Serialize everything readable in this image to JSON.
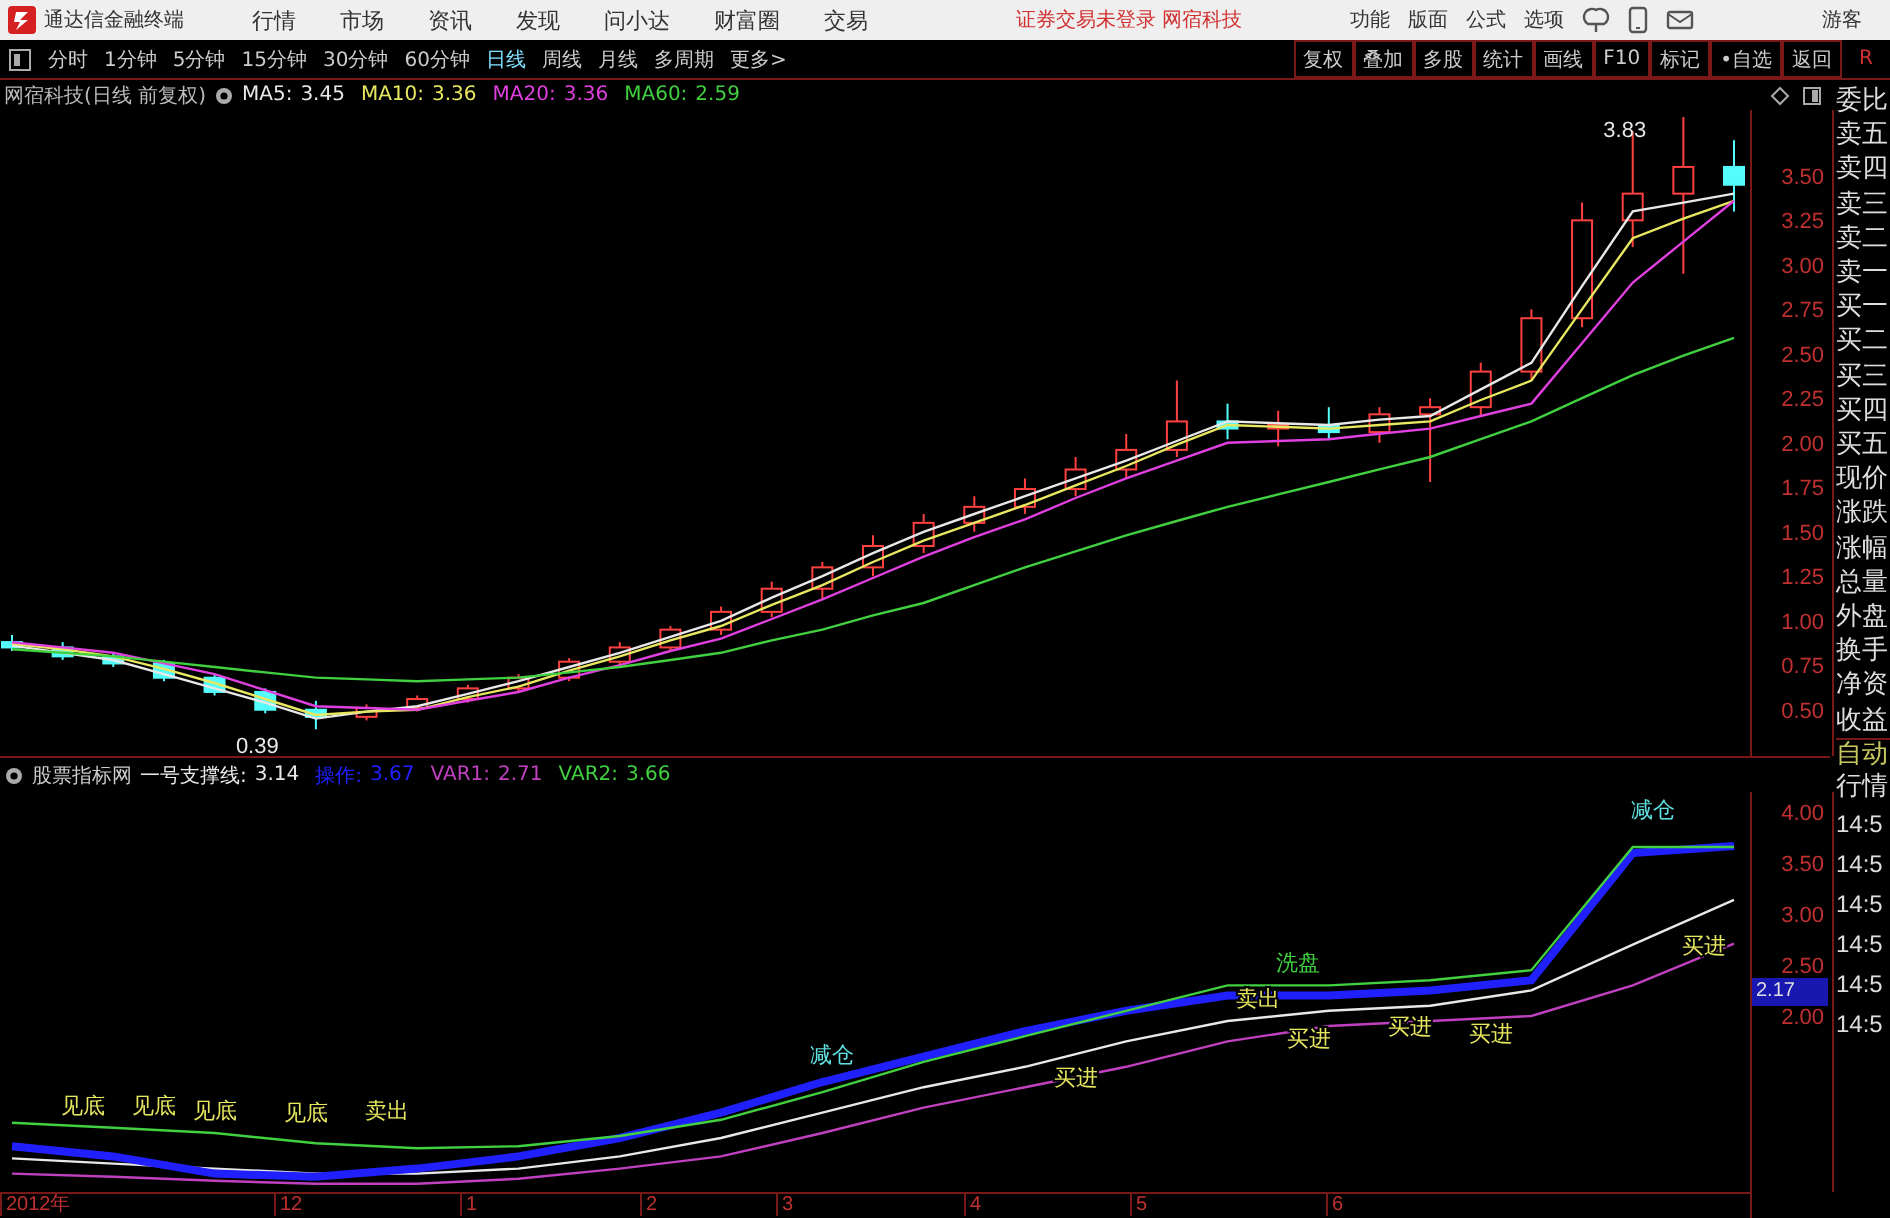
{
  "app": {
    "title": "通达信金融终端",
    "menu": [
      "行情",
      "市场",
      "资讯",
      "发现",
      "问小达",
      "财富圈",
      "交易"
    ],
    "notice": "证券交易未登录 网宿科技",
    "tools": [
      "功能",
      "版面",
      "公式",
      "选项"
    ],
    "user": "游客"
  },
  "periods": [
    {
      "label": "分时",
      "selected": false
    },
    {
      "label": "1分钟",
      "selected": false
    },
    {
      "label": "5分钟",
      "selected": false
    },
    {
      "label": "15分钟",
      "selected": false
    },
    {
      "label": "30分钟",
      "selected": false
    },
    {
      "label": "60分钟",
      "selected": false
    },
    {
      "label": "日线",
      "selected": true
    },
    {
      "label": "周线",
      "selected": false
    },
    {
      "label": "月线",
      "selected": false
    },
    {
      "label": "多周期",
      "selected": false
    },
    {
      "label": "更多>",
      "selected": false
    }
  ],
  "actions": [
    "复权",
    "叠加",
    "多股",
    "统计",
    "画线",
    "F10",
    "标记",
    "•自选",
    "返回"
  ],
  "corner_mark": "R",
  "price_chart": {
    "title": "网宿科技(日线 前复权)",
    "readings": [
      "3.45",
      "3.36",
      "3.36",
      "2.59"
    ],
    "chart_data": {
      "type": "candlestick",
      "ylim": [
        0.24,
        3.87
      ],
      "yticks": [
        {
          "value": 0.5,
          "label": "0.50"
        },
        {
          "value": 0.75,
          "label": "0.75"
        },
        {
          "value": 1,
          "label": "1.00"
        },
        {
          "value": 1.25,
          "label": "1.25"
        },
        {
          "value": 1.5,
          "label": "1.50"
        },
        {
          "value": 1.75,
          "label": "1.75"
        },
        {
          "value": 2,
          "label": "2.00"
        },
        {
          "value": 2.25,
          "label": "2.25"
        },
        {
          "value": 2.5,
          "label": "2.50"
        },
        {
          "value": 2.75,
          "label": "2.75"
        },
        {
          "value": 3,
          "label": "3.00"
        },
        {
          "value": 3.25,
          "label": "3.25"
        },
        {
          "value": 3.5,
          "label": "3.50"
        }
      ],
      "ohlc": [
        [
          0.88,
          0.92,
          0.83,
          0.85
        ],
        [
          0.85,
          0.88,
          0.78,
          0.8
        ],
        [
          0.8,
          0.82,
          0.74,
          0.76
        ],
        [
          0.76,
          0.78,
          0.66,
          0.68
        ],
        [
          0.68,
          0.7,
          0.58,
          0.6
        ],
        [
          0.6,
          0.62,
          0.48,
          0.5
        ],
        [
          0.5,
          0.55,
          0.39,
          0.46
        ],
        [
          0.46,
          0.53,
          0.44,
          0.51
        ],
        [
          0.51,
          0.58,
          0.49,
          0.56
        ],
        [
          0.56,
          0.64,
          0.54,
          0.62
        ],
        [
          0.62,
          0.7,
          0.6,
          0.68
        ],
        [
          0.68,
          0.79,
          0.66,
          0.77
        ],
        [
          0.77,
          0.88,
          0.75,
          0.85
        ],
        [
          0.85,
          0.97,
          0.83,
          0.95
        ],
        [
          0.95,
          1.08,
          0.92,
          1.05
        ],
        [
          1.05,
          1.22,
          1.02,
          1.18
        ],
        [
          1.18,
          1.33,
          1.12,
          1.3
        ],
        [
          1.3,
          1.48,
          1.25,
          1.42
        ],
        [
          1.42,
          1.6,
          1.38,
          1.55
        ],
        [
          1.55,
          1.7,
          1.5,
          1.64
        ],
        [
          1.64,
          1.8,
          1.6,
          1.74
        ],
        [
          1.74,
          1.92,
          1.7,
          1.85
        ],
        [
          1.85,
          2.05,
          1.8,
          1.96
        ],
        [
          1.96,
          2.35,
          1.92,
          2.12
        ],
        [
          2.12,
          2.22,
          2.02,
          2.08
        ],
        [
          2.08,
          2.18,
          1.98,
          2.1
        ],
        [
          2.1,
          2.2,
          2.02,
          2.06
        ],
        [
          2.06,
          2.2,
          2.0,
          2.16
        ],
        [
          2.16,
          2.25,
          1.78,
          2.2
        ],
        [
          2.2,
          2.45,
          2.15,
          2.4
        ],
        [
          2.4,
          2.75,
          2.35,
          2.7
        ],
        [
          2.7,
          3.35,
          2.65,
          3.25
        ],
        [
          3.25,
          3.75,
          3.1,
          3.4
        ],
        [
          3.4,
          3.83,
          2.95,
          3.55
        ],
        [
          3.55,
          3.7,
          3.3,
          3.45
        ]
      ],
      "series": [
        {
          "name": "MA5:",
          "type": "line",
          "color": "#e8e8e8",
          "values": [
            0.86,
            0.82,
            0.78,
            0.7,
            0.62,
            0.54,
            0.45,
            0.49,
            0.52,
            0.59,
            0.66,
            0.74,
            0.82,
            0.91,
            1.0,
            1.13,
            1.25,
            1.38,
            1.5,
            1.6,
            1.7,
            1.8,
            1.9,
            2.01,
            2.12,
            2.11,
            2.1,
            2.13,
            2.15,
            2.3,
            2.45,
            2.88,
            3.3,
            3.35,
            3.4
          ]
        },
        {
          "name": "MA10:",
          "type": "line",
          "color": "#e8e860",
          "values": [
            0.87,
            0.84,
            0.8,
            0.73,
            0.65,
            0.56,
            0.47,
            0.49,
            0.5,
            0.57,
            0.63,
            0.72,
            0.8,
            0.89,
            0.97,
            1.09,
            1.2,
            1.33,
            1.45,
            1.55,
            1.65,
            1.76,
            1.87,
            1.99,
            2.1,
            2.09,
            2.08,
            2.1,
            2.12,
            2.24,
            2.35,
            2.75,
            3.15,
            3.26,
            3.36
          ]
        },
        {
          "name": "MA20:",
          "type": "line",
          "color": "#e040e0",
          "values": [
            0.88,
            0.85,
            0.82,
            0.76,
            0.7,
            0.61,
            0.52,
            0.51,
            0.5,
            0.55,
            0.6,
            0.68,
            0.75,
            0.83,
            0.9,
            1.01,
            1.12,
            1.24,
            1.36,
            1.47,
            1.57,
            1.69,
            1.8,
            1.9,
            2.0,
            2.01,
            2.02,
            2.05,
            2.08,
            2.15,
            2.22,
            2.56,
            2.9,
            3.13,
            3.36
          ]
        },
        {
          "name": "MA60:",
          "type": "line",
          "color": "#40d040",
          "values": [
            0.84,
            0.82,
            0.8,
            0.77,
            0.74,
            0.71,
            0.68,
            0.67,
            0.66,
            0.67,
            0.68,
            0.71,
            0.74,
            0.78,
            0.82,
            0.89,
            0.95,
            1.03,
            1.1,
            1.2,
            1.3,
            1.39,
            1.48,
            1.56,
            1.64,
            1.71,
            1.78,
            1.85,
            1.92,
            2.02,
            2.12,
            2.25,
            2.38,
            2.49,
            2.59
          ]
        }
      ],
      "annotations": [
        "3.83",
        "0.39"
      ]
    }
  },
  "indicator_chart": {
    "source": "股票指标网",
    "readings": [
      "3.14",
      "3.67",
      "2.71",
      "3.66"
    ],
    "chart_data": {
      "type": "line",
      "ylim": [
        0.27,
        4.2
      ],
      "yticks": [
        {
          "value": 2,
          "label": "2.00"
        },
        {
          "value": 2.5,
          "label": "2.50"
        },
        {
          "value": 3,
          "label": "3.00"
        },
        {
          "value": 3.5,
          "label": "3.50"
        },
        {
          "value": 4,
          "label": "4.00"
        }
      ],
      "series": [
        {
          "name": "一号支撑线:",
          "color": "#e8e8e8",
          "values": [
            0.6,
            0.55,
            0.5,
            0.45,
            0.45,
            0.5,
            0.62,
            0.8,
            1.05,
            1.3,
            1.5,
            1.75,
            1.95,
            2.05,
            2.1,
            2.25,
            2.7,
            3.14
          ]
        },
        {
          "name": "操作:",
          "color": "#2020ff",
          "values": [
            0.72,
            0.62,
            0.45,
            0.42,
            0.5,
            0.62,
            0.8,
            1.05,
            1.35,
            1.6,
            1.85,
            2.05,
            2.2,
            2.2,
            2.25,
            2.35,
            3.6,
            3.67
          ]
        },
        {
          "name": "VAR1:",
          "color": "#c040c0",
          "values": [
            0.45,
            0.42,
            0.38,
            0.35,
            0.35,
            0.4,
            0.5,
            0.62,
            0.85,
            1.1,
            1.3,
            1.5,
            1.75,
            1.9,
            1.95,
            2.0,
            2.3,
            2.71
          ]
        },
        {
          "name": "VAR2:",
          "color": "#40d040",
          "values": [
            0.95,
            0.9,
            0.85,
            0.75,
            0.7,
            0.72,
            0.82,
            0.98,
            1.25,
            1.55,
            1.8,
            2.05,
            2.3,
            2.3,
            2.35,
            2.45,
            3.66,
            3.66
          ]
        }
      ],
      "annotations": [
        "见底",
        "见底",
        "见底",
        "见底",
        "卖出",
        "减仓",
        "买进",
        "洗盘",
        "卖出",
        "买进",
        "买进",
        "买进",
        "减仓",
        "买进"
      ]
    },
    "signal_styles": [
      {
        "color": "#e8e860"
      },
      {
        "color": "#e8e860"
      },
      {
        "color": "#e8e860"
      },
      {
        "color": "#e8e860"
      },
      {
        "color": "#e8e860"
      },
      {
        "color": "#60e0e0"
      },
      {
        "color": "#e8e860"
      },
      {
        "color": "#40d040"
      },
      {
        "color": "#e8e860"
      },
      {
        "color": "#e8e860"
      },
      {
        "color": "#e8e860"
      },
      {
        "color": "#e8e860"
      },
      {
        "color": "#60e0e0"
      },
      {
        "color": "#e8e860"
      }
    ],
    "current_value": "2.17"
  },
  "time_axis": [
    "2012年",
    "12",
    "1",
    "2",
    "3",
    "4",
    "5",
    "6"
  ],
  "quote_panel": {
    "labels": [
      "委比",
      "卖五",
      "卖四",
      "卖三",
      "卖二",
      "卖一",
      "买一",
      "买二",
      "买三",
      "买四",
      "买五",
      "现价",
      "涨跌",
      "涨幅",
      "总量",
      "外盘",
      "换手",
      "净资",
      "收益"
    ],
    "tabs": [
      "自动",
      "行情"
    ],
    "times": [
      "14:5",
      "14:5",
      "14:5",
      "14:5",
      "14:5",
      "14:5"
    ]
  }
}
